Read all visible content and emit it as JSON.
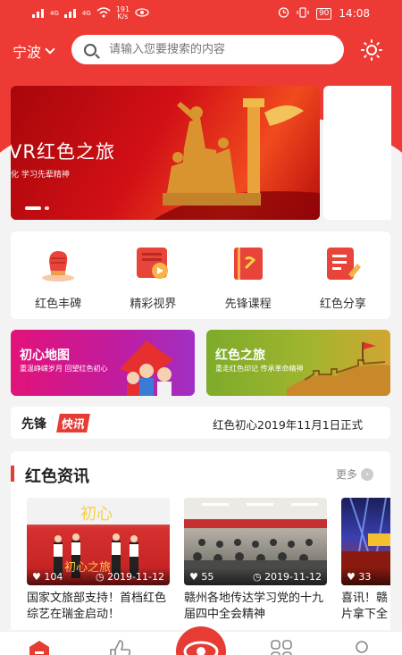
{
  "status_bar": {
    "signal1": "4G",
    "signal2": "4G",
    "speed": "191",
    "speed_unit": "K/s",
    "battery": "90",
    "time": "14:08"
  },
  "header": {
    "city": "宁波",
    "search_placeholder": "请输入您要搜索的内容"
  },
  "banner": {
    "title": "VR红色之旅",
    "subtitle": "化 学习先辈精神"
  },
  "quick_menu": [
    {
      "label": "红色丰碑",
      "icon": "fist-icon"
    },
    {
      "label": "精彩视界",
      "icon": "video-icon"
    },
    {
      "label": "先锋课程",
      "icon": "party-book-icon"
    },
    {
      "label": "红色分享",
      "icon": "share-edit-icon"
    }
  ],
  "promos": [
    {
      "title": "初心地图",
      "subtitle": "重温峥嵘岁月  回望红色初心"
    },
    {
      "title": "红色之旅",
      "subtitle": "重走红色印记  传承革命精神"
    }
  ],
  "ticker": {
    "brand_a": "先锋",
    "brand_b": "快讯",
    "text": "红色初心2019年11月1日正式"
  },
  "news": {
    "title": "红色资讯",
    "more": "更多",
    "cards": [
      {
        "likes": "104",
        "date": "2019-11-12",
        "caption": "国家文旅部支持！首档红色综艺在瑞金启动！"
      },
      {
        "likes": "55",
        "date": "2019-11-12",
        "caption": "赣州各地传达学习党的十九届四中全会精神"
      },
      {
        "likes": "33",
        "date": "",
        "caption": "喜讯！赣片拿下全"
      }
    ]
  },
  "colors": {
    "brand_red": "#ee3a34",
    "background": "#f3f3f3"
  }
}
